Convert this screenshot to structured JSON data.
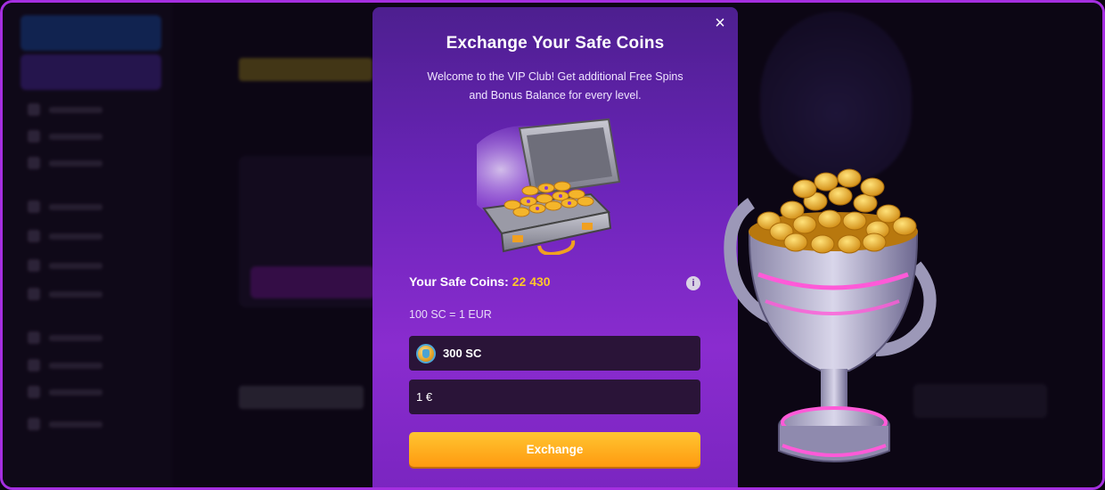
{
  "modal": {
    "title": "Exchange Your Safe Coins",
    "description": "Welcome to the VIP Club! Get additional Free Spins and Bonus Balance for every level.",
    "close_label": "×",
    "balance_label": "Your Safe Coins:",
    "balance_value": "22 430",
    "info_label": "i",
    "rate_text": "100 SC = 1 EUR",
    "sc_field_value": "300 SC",
    "eur_field_value": "1 €",
    "exchange_button": "Exchange"
  },
  "colors": {
    "accent": "#ffc62a",
    "button": "#ff9a10",
    "modal_bg": "#6a24b8",
    "frame_border": "#a52fe0"
  },
  "icons": {
    "close": "close-icon",
    "info": "info-icon",
    "sc_coin": "safe-coin-icon",
    "chest": "coin-chest-image",
    "trophy": "trophy-image"
  }
}
